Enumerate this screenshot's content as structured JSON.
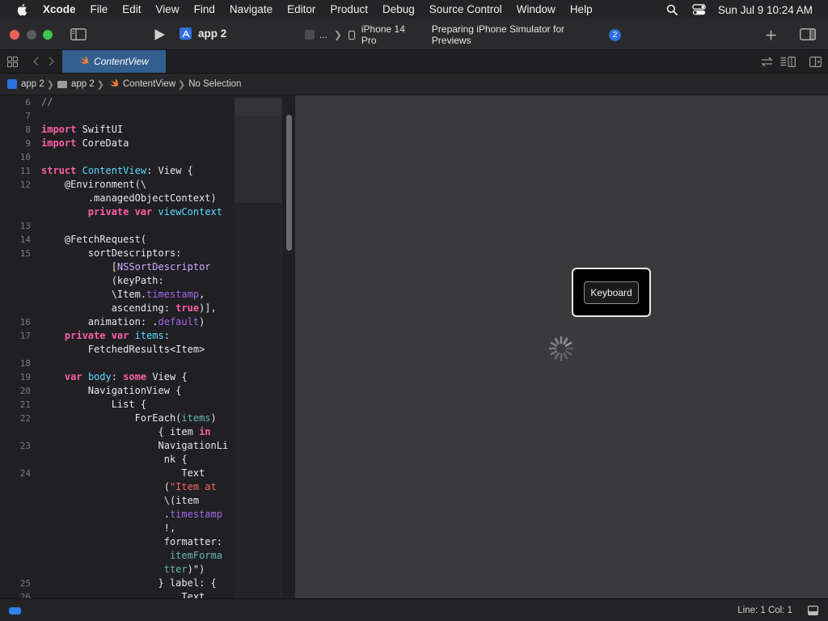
{
  "menubar": {
    "app_name": "Xcode",
    "items": [
      "File",
      "Edit",
      "View",
      "Find",
      "Navigate",
      "Editor",
      "Product",
      "Debug",
      "Source Control",
      "Window",
      "Help"
    ],
    "datetime": "Sun Jul 9  10:24 AM"
  },
  "toolbar": {
    "scheme_name": "app 2",
    "destination_truncated": "...",
    "device": "iPhone 14 Pro",
    "status": "Preparing iPhone Simulator for Previews",
    "status_count": "2"
  },
  "tabbar": {
    "active_tab": "ContentView"
  },
  "jumpbar": {
    "crumbs": [
      "app 2",
      "app 2",
      "ContentView",
      "No Selection"
    ]
  },
  "editor": {
    "line_numbers": [
      {
        "n": "6",
        "row": 0
      },
      {
        "n": "7",
        "row": 1
      },
      {
        "n": "8",
        "row": 2
      },
      {
        "n": "9",
        "row": 3
      },
      {
        "n": "10",
        "row": 4
      },
      {
        "n": "11",
        "row": 5
      },
      {
        "n": "12",
        "row": 6
      },
      {
        "n": "13",
        "row": 9
      },
      {
        "n": "14",
        "row": 10
      },
      {
        "n": "15",
        "row": 11
      },
      {
        "n": "16",
        "row": 16
      },
      {
        "n": "17",
        "row": 17
      },
      {
        "n": "18",
        "row": 19
      },
      {
        "n": "19",
        "row": 20
      },
      {
        "n": "20",
        "row": 21
      },
      {
        "n": "21",
        "row": 22
      },
      {
        "n": "22",
        "row": 23
      },
      {
        "n": "23",
        "row": 25
      },
      {
        "n": "24",
        "row": 27
      },
      {
        "n": "25",
        "row": 35
      },
      {
        "n": "26",
        "row": 36
      }
    ],
    "lines": [
      [
        [
          "cmt",
          "//"
        ]
      ],
      [],
      [
        [
          "kw",
          "import"
        ],
        [
          "",
          " SwiftUI"
        ]
      ],
      [
        [
          "kw",
          "import"
        ],
        [
          "",
          " CoreData"
        ]
      ],
      [],
      [
        [
          "kw",
          "struct"
        ],
        [
          "",
          " "
        ],
        [
          "ty",
          "ContentView"
        ],
        [
          "",
          ": View {"
        ]
      ],
      [
        [
          "",
          "    @Environment(\\"
        ]
      ],
      [
        [
          "",
          "        .managedObjectContext)"
        ]
      ],
      [
        [
          "",
          "        "
        ],
        [
          "kw",
          "private var"
        ],
        [
          "",
          " "
        ],
        [
          "ty",
          "viewContext"
        ]
      ],
      [],
      [
        [
          "",
          "    @FetchRequest("
        ]
      ],
      [
        [
          "",
          "        sortDescriptors:"
        ]
      ],
      [
        [
          "",
          "            ["
        ],
        [
          "tp",
          "NSSortDescriptor"
        ]
      ],
      [
        [
          "",
          "            (keyPath:"
        ]
      ],
      [
        [
          "",
          "            \\Item."
        ],
        [
          "prop",
          "timestamp"
        ],
        [
          "",
          ","
        ]
      ],
      [
        [
          "",
          "            ascending: "
        ],
        [
          "kw",
          "true"
        ],
        [
          "",
          ")],"
        ]
      ],
      [
        [
          "",
          "        animation: ."
        ],
        [
          "prop",
          "default"
        ],
        [
          "",
          ")"
        ]
      ],
      [
        [
          "",
          "    "
        ],
        [
          "kw",
          "private var"
        ],
        [
          "",
          " "
        ],
        [
          "ty",
          "items"
        ],
        [
          "",
          ":"
        ]
      ],
      [
        [
          "",
          "        FetchedResults<Item>"
        ]
      ],
      [],
      [
        [
          "",
          "    "
        ],
        [
          "kw",
          "var"
        ],
        [
          "",
          " "
        ],
        [
          "ty",
          "body"
        ],
        [
          "",
          ": "
        ],
        [
          "kw",
          "some"
        ],
        [
          "",
          " View {"
        ]
      ],
      [
        [
          "",
          "        NavigationView {"
        ]
      ],
      [
        [
          "",
          "            List {"
        ]
      ],
      [
        [
          "",
          "                ForEach("
        ],
        [
          "fn",
          "items"
        ],
        [
          "",
          ")"
        ]
      ],
      [
        [
          "",
          "                    { item "
        ],
        [
          "kw",
          "in"
        ]
      ],
      [
        [
          "",
          "                    NavigationLi"
        ]
      ],
      [
        [
          "",
          "                     nk {"
        ]
      ],
      [
        [
          "",
          "                        Text"
        ]
      ],
      [
        [
          "",
          "                     ("
        ],
        [
          "str",
          "\"Item at"
        ]
      ],
      [
        [
          "",
          "                     \\(item"
        ]
      ],
      [
        [
          "",
          "                     ."
        ],
        [
          "prop",
          "timestamp"
        ]
      ],
      [
        [
          "",
          "                     !,"
        ]
      ],
      [
        [
          "",
          "                     formatter:"
        ]
      ],
      [
        [
          "",
          "                      "
        ],
        [
          "fn",
          "itemForma"
        ]
      ],
      [
        [
          "",
          "                     "
        ],
        [
          "fn",
          "tter"
        ],
        [
          "",
          ")\")"
        ]
      ],
      [
        [
          "",
          "                    } label: {"
        ]
      ],
      [
        [
          "",
          "                        Text"
        ]
      ]
    ]
  },
  "canvas": {
    "keyboard_button": "Keyboard"
  },
  "statusbar": {
    "position": "Line: 1  Col: 1"
  }
}
